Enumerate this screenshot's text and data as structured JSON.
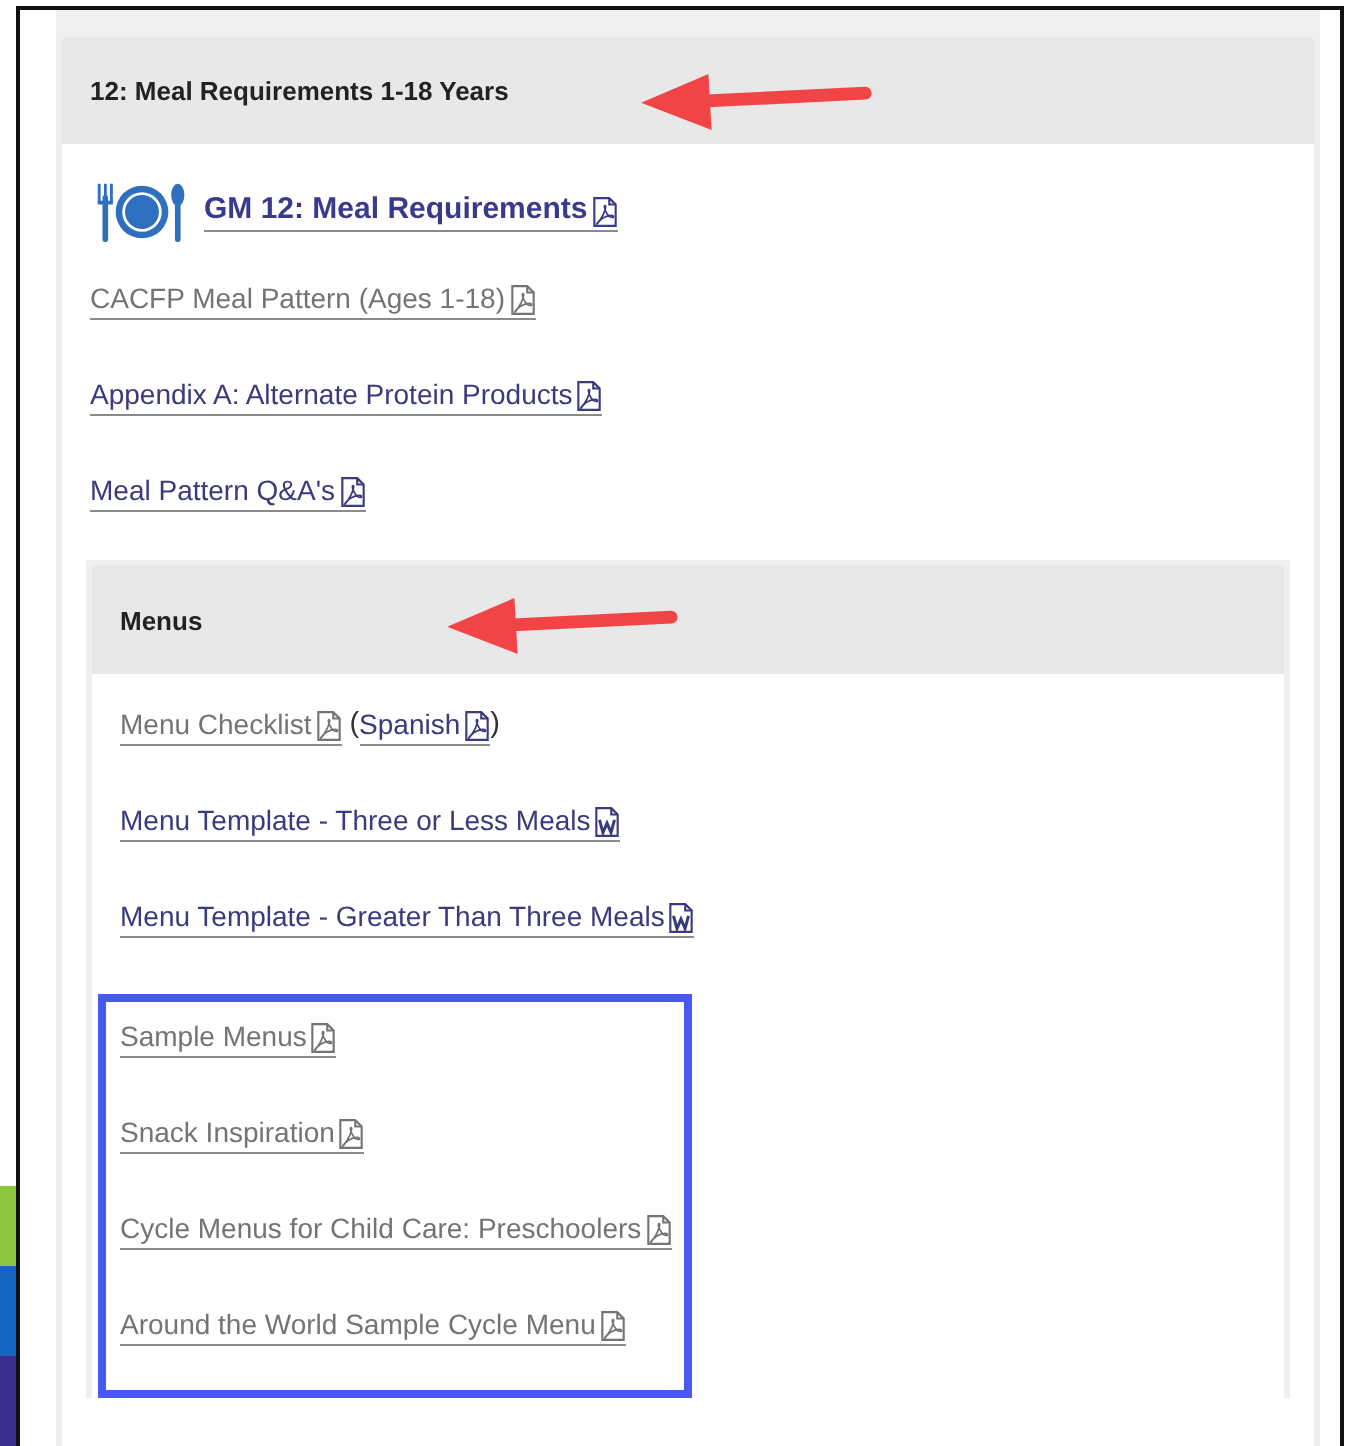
{
  "section": {
    "title": "12: Meal Requirements 1-18 Years",
    "arrow": true,
    "featured": {
      "label": "GM 12: Meal Requirements",
      "kind": "pdf",
      "visited": false
    },
    "links": [
      {
        "label": "CACFP Meal Pattern (Ages 1-18)",
        "kind": "pdf",
        "visited": true
      },
      {
        "label": "Appendix A: Alternate Protein Products",
        "kind": "pdf",
        "visited": false
      },
      {
        "label": "Meal Pattern Q&A's",
        "kind": "pdf",
        "visited": false
      }
    ],
    "subsection": {
      "title": "Menus",
      "arrow": true,
      "groups": [
        {
          "highlighted": false,
          "items": [
            {
              "label": "Menu Checklist",
              "kind": "pdf",
              "visited": true,
              "alternate": {
                "open": "(",
                "label": "Spanish",
                "kind": "pdf",
                "visited": false,
                "close": ")"
              }
            },
            {
              "label": "Menu Template - Three or Less Meals",
              "kind": "word",
              "visited": false
            },
            {
              "label": "Menu Template - Greater Than Three Meals",
              "kind": "word",
              "visited": false
            }
          ]
        },
        {
          "highlighted": true,
          "items": [
            {
              "label": "Sample Menus",
              "kind": "pdf",
              "visited": true
            },
            {
              "label": "Snack Inspiration",
              "kind": "pdf",
              "visited": true
            },
            {
              "label": "Cycle Menus for Child Care: Preschoolers",
              "kind": "pdf",
              "visited": true
            },
            {
              "label": "Around the World Sample Cycle Menu",
              "kind": "pdf",
              "visited": true
            }
          ]
        }
      ]
    }
  }
}
